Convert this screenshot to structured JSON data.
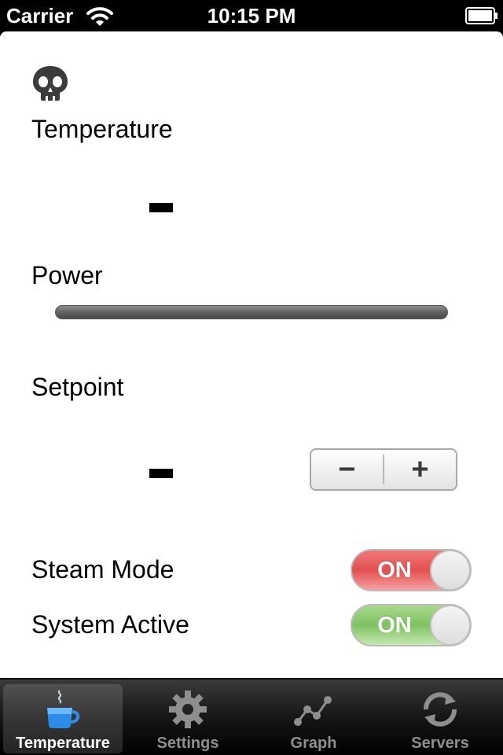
{
  "status_bar": {
    "carrier": "Carrier",
    "time": "10:15 PM",
    "icons": [
      "wifi-icon",
      "battery-icon"
    ]
  },
  "main": {
    "header_icon": "skull-icon",
    "temperature_label": "Temperature",
    "temperature_value": "-",
    "power_label": "Power",
    "power_fraction": 0,
    "setpoint_label": "Setpoint",
    "setpoint_value": "-",
    "stepper": {
      "minus": "−",
      "plus": "+"
    },
    "steam_mode": {
      "label": "Steam Mode",
      "state": "ON",
      "color": "#e25050"
    },
    "system_active": {
      "label": "System Active",
      "state": "ON",
      "color": "#7fc261"
    }
  },
  "tabbar": {
    "selected": "Temperature",
    "tabs": [
      {
        "label": "Temperature",
        "icon": "coffee-cup-icon"
      },
      {
        "label": "Settings",
        "icon": "gear-icon"
      },
      {
        "label": "Graph",
        "icon": "graph-icon"
      },
      {
        "label": "Servers",
        "icon": "refresh-icon"
      }
    ]
  },
  "colors": {
    "accent_blue": "#2a7be0",
    "tab_inactive": "#8e8e8e"
  }
}
